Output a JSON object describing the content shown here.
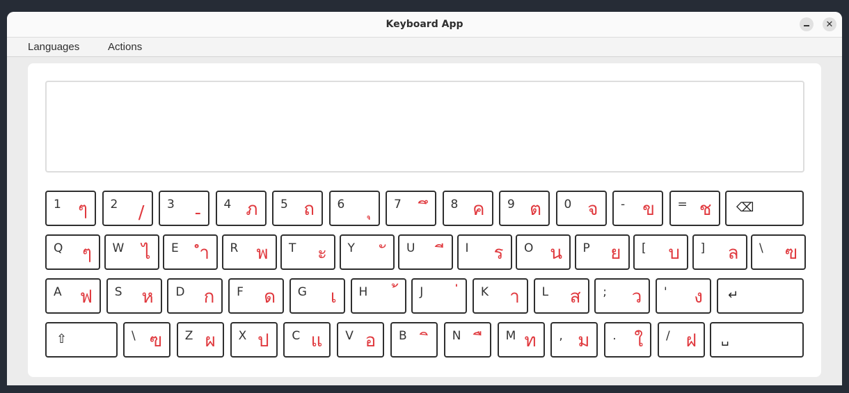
{
  "window": {
    "title": "Keyboard App"
  },
  "menu": {
    "languages": "Languages",
    "actions": "Actions"
  },
  "text_area": {
    "value": ""
  },
  "keyboard": {
    "row1": [
      {
        "en": "1",
        "th": "ๆ"
      },
      {
        "en": "2",
        "th": "/"
      },
      {
        "en": "3",
        "th": "-"
      },
      {
        "en": "4",
        "th": "ภ"
      },
      {
        "en": "5",
        "th": "ถ"
      },
      {
        "en": "6",
        "th": "ุ"
      },
      {
        "en": "7",
        "th": "ึ"
      },
      {
        "en": "8",
        "th": "ค"
      },
      {
        "en": "9",
        "th": "ต"
      },
      {
        "en": "0",
        "th": "จ"
      },
      {
        "en": "-",
        "th": "ข"
      },
      {
        "en": "=",
        "th": "ช"
      }
    ],
    "row2": [
      {
        "en": "Q",
        "th": "ๆ"
      },
      {
        "en": "W",
        "th": "ไ"
      },
      {
        "en": "E",
        "th": "ำ"
      },
      {
        "en": "R",
        "th": "พ"
      },
      {
        "en": "T",
        "th": "ะ"
      },
      {
        "en": "Y",
        "th": "ั"
      },
      {
        "en": "U",
        "th": "ี"
      },
      {
        "en": "I",
        "th": "ร"
      },
      {
        "en": "O",
        "th": "น"
      },
      {
        "en": "P",
        "th": "ย"
      },
      {
        "en": "[",
        "th": "บ"
      },
      {
        "en": "]",
        "th": "ล"
      },
      {
        "en": "\\",
        "th": "ฃ"
      }
    ],
    "row3": [
      {
        "en": "A",
        "th": "ฟ"
      },
      {
        "en": "S",
        "th": "ห"
      },
      {
        "en": "D",
        "th": "ก"
      },
      {
        "en": "F",
        "th": "ด"
      },
      {
        "en": "G",
        "th": "เ"
      },
      {
        "en": "H",
        "th": "้"
      },
      {
        "en": "J",
        "th": "่"
      },
      {
        "en": "K",
        "th": "า"
      },
      {
        "en": "L",
        "th": "ส"
      },
      {
        "en": ";",
        "th": "ว"
      },
      {
        "en": "'",
        "th": "ง"
      }
    ],
    "row4": [
      {
        "en": "\\",
        "th": "ฃ"
      },
      {
        "en": "Z",
        "th": "ผ"
      },
      {
        "en": "X",
        "th": "ป"
      },
      {
        "en": "C",
        "th": "แ"
      },
      {
        "en": "V",
        "th": "อ"
      },
      {
        "en": "B",
        "th": "ิ"
      },
      {
        "en": "N",
        "th": "ื"
      },
      {
        "en": "M",
        "th": "ท"
      },
      {
        "en": ",",
        "th": "ม"
      },
      {
        "en": ".",
        "th": "ใ"
      },
      {
        "en": "/",
        "th": "ฝ"
      }
    ],
    "special": {
      "backspace": "⌫",
      "enter": "↵",
      "shift": "⇧",
      "space": "␣"
    }
  }
}
